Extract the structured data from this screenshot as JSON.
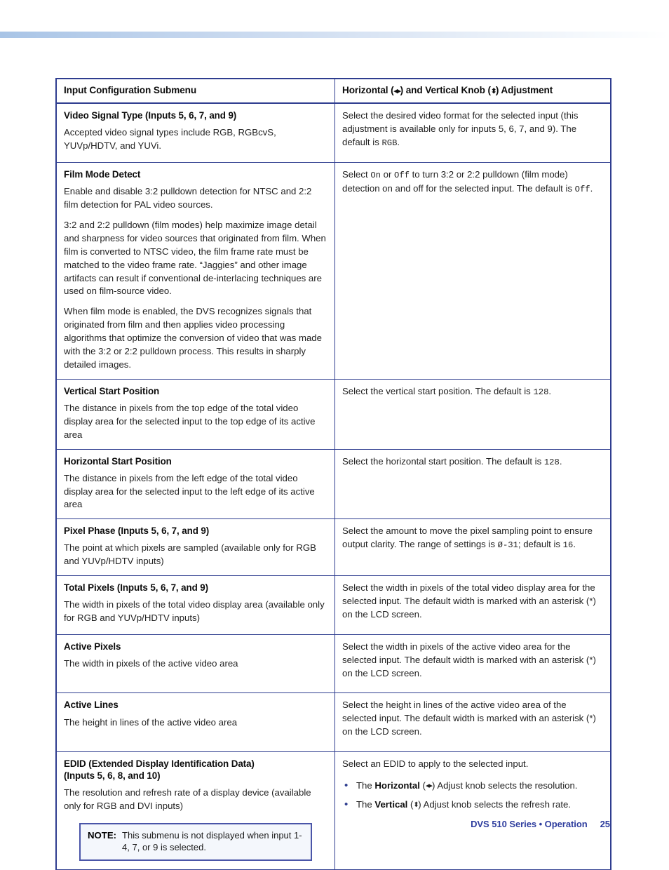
{
  "document": {
    "footer_title": "DVS 510 Series • Operation",
    "page_number": "25"
  },
  "table": {
    "headers": {
      "col1": "Input Configuration Submenu",
      "col2_pre": "Horizontal (",
      "col2_arrow_h": "◂▸",
      "col2_mid": ") and Vertical Knob (",
      "col2_arrow_v": "⬍",
      "col2_post": ") Adjustment"
    },
    "rows": [
      {
        "term": "Video Signal Type (Inputs 5, 6, 7, and 9)",
        "desc": [
          "Accepted video signal types include RGB, RGBcvS, YUVp/HDTV, and YUVi."
        ],
        "right": {
          "pre": "Select the desired video format for the selected input (this adjustment is available only for inputs 5, 6, 7, and 9). The default is ",
          "mono1": "RGB",
          "post": "."
        }
      },
      {
        "term": "Film Mode Detect",
        "desc": [
          "Enable and disable 3:2 pulldown detection for NTSC and 2:2 film detection for PAL video sources.",
          "3:2 and 2:2 pulldown (film modes) help maximize image detail and sharpness for video sources that originated from film. When film is converted to NTSC video, the film frame rate must be matched to the video frame rate. “Jaggies” and other image artifacts can result if conventional de-interlacing techniques are used on film-source video.",
          "When film mode is enabled, the DVS recognizes signals that originated from film and then applies video processing algorithms that optimize the conversion of video that was made with the 3:2 or 2:2 pulldown process. This results in sharply detailed images."
        ],
        "right": {
          "pre": "Select ",
          "mono1": "On",
          "mid1": " or ",
          "mono2": "Off",
          "mid2": " to turn 3:2 or 2:2 pulldown (film mode) detection on and off for the selected input. The default is ",
          "mono3": "Off",
          "post": "."
        }
      },
      {
        "term": "Vertical Start Position",
        "desc": [
          "The distance in pixels from the top edge of the total video display area for the selected input to the top edge of its active area"
        ],
        "right": {
          "pre": "Select the vertical start position. The default is ",
          "mono1": "128",
          "post": "."
        }
      },
      {
        "term": "Horizontal Start Position",
        "desc": [
          "The distance in pixels from the left edge of the total video display area for the selected input to the left edge of its active area"
        ],
        "right": {
          "pre": "Select the horizontal start position. The default is ",
          "mono1": "128",
          "post": "."
        }
      },
      {
        "term": "Pixel Phase (Inputs 5, 6, 7, and 9)",
        "desc": [
          "The point at which pixels are sampled (available only for RGB and YUVp/HDTV inputs)"
        ],
        "right": {
          "pre": "Select the amount to move the pixel sampling point to ensure output clarity. The range of settings is ",
          "mono1": "Ø-31",
          "mid1": "; default is ",
          "mono2": "16",
          "post": "."
        }
      },
      {
        "term": "Total Pixels (Inputs 5, 6, 7, and 9)",
        "desc": [
          "The width in pixels of the total video display area (available only for RGB and YUVp/HDTV inputs)"
        ],
        "right": {
          "pre": "Select the width in pixels of the total video display area for the selected input. The default width is marked with an asterisk (*) on the LCD screen."
        }
      },
      {
        "term": "Active Pixels",
        "desc": [
          "The width in pixels of the active video area"
        ],
        "right": {
          "pre": "Select the width in pixels of the active video area for the selected input. The default width is marked with an asterisk (*) on the LCD screen."
        }
      },
      {
        "term": "Active Lines",
        "desc": [
          "The height in lines of the active video area"
        ],
        "right": {
          "pre": "Select the height in lines of the active video area of the selected input. The default width is marked with an asterisk (*) on the LCD screen."
        }
      }
    ],
    "edid_row": {
      "term_line1": "EDID (Extended Display Identification Data)",
      "term_line2": "(Inputs 5, 6, 8, and 10)",
      "desc": "The resolution and refresh rate of a display device (available only for RGB and DVI inputs)",
      "note": {
        "label": "NOTE:",
        "text": "This submenu is not displayed when input 1-4, 7, or 9 is selected."
      },
      "right": {
        "intro": "Select an EDID to apply to the selected input.",
        "bullets": [
          {
            "pre": "The ",
            "bold": "Horizontal",
            "arrow": "◂▸",
            "arrow_type": "h",
            "post": " Adjust knob selects the resolution."
          },
          {
            "pre": "The ",
            "bold": "Vertical",
            "arrow": "⬍",
            "arrow_type": "v",
            "post": " Adjust knob selects the refresh rate."
          }
        ]
      }
    }
  },
  "colors": {
    "table_border": "#2e3d8f",
    "note_border": "#4a55a8",
    "note_bg": "#f4f7fc",
    "footer_text": "#2e3d9e",
    "band_start": "#a8c4e6"
  }
}
